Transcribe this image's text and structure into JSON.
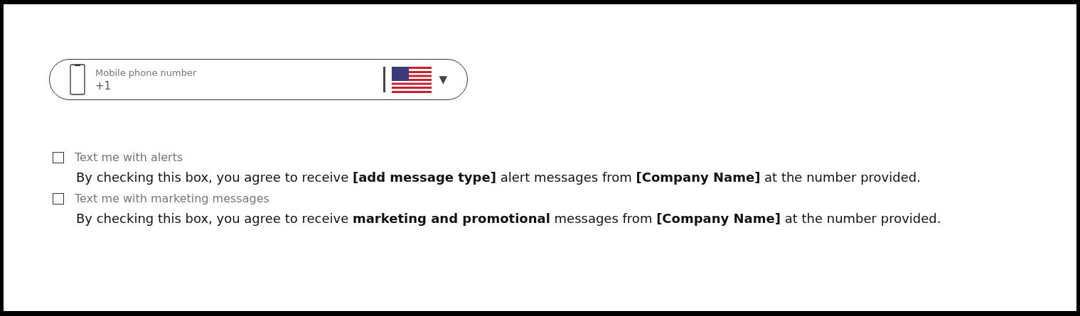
{
  "phone_field": {
    "label": "Mobile phone number",
    "value": "+1",
    "dropdown_symbol": "▼"
  },
  "consents": [
    {
      "label": "Text me with alerts",
      "checked": false,
      "description": "By checking this box, you agree to receive **[add message type]** alert messages from **[Company Name]** at the number provided."
    },
    {
      "label": "Text me with marketing messages",
      "checked": false,
      "description": "By checking this box, you agree to receive **marketing and promotional** messages from **[Company Name]** at the number provided."
    }
  ]
}
